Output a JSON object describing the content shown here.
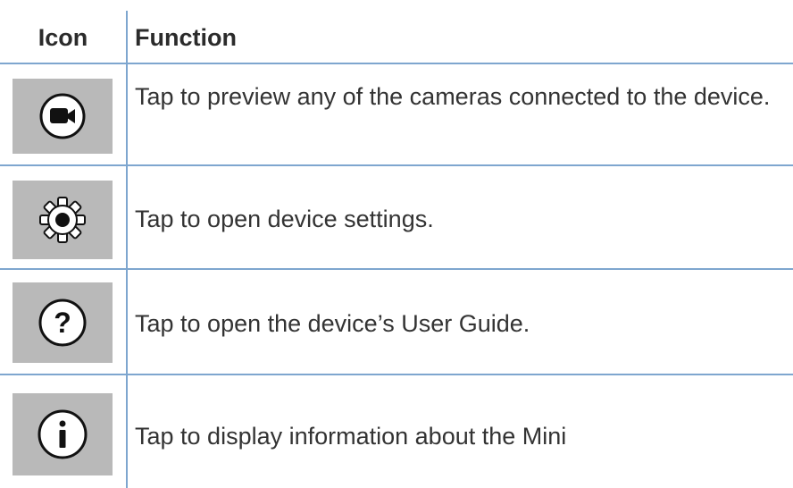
{
  "table": {
    "headers": {
      "icon": "Icon",
      "function": "Function"
    },
    "rows": [
      {
        "icon": "camera-icon",
        "function": "Tap to preview any of the cameras connected to the device."
      },
      {
        "icon": "gear-icon",
        "function": "Tap to open device settings."
      },
      {
        "icon": "help-icon",
        "function": "Tap to open the device’s User Guide."
      },
      {
        "icon": "info-icon",
        "function": "Tap to display information about the Mini"
      }
    ]
  },
  "colors": {
    "rule": "#7ea6cf",
    "icon_background": "#b9b9b9",
    "text": "#333333"
  }
}
